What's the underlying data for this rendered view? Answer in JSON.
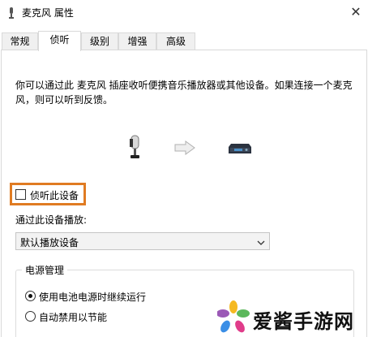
{
  "window": {
    "title": "麦克风 属性",
    "close_glyph": "✕"
  },
  "tabs": [
    {
      "label": "常规",
      "active": false
    },
    {
      "label": "侦听",
      "active": true
    },
    {
      "label": "级别",
      "active": false
    },
    {
      "label": "增强",
      "active": false
    },
    {
      "label": "高级",
      "active": false
    }
  ],
  "listen": {
    "description": "你可以通过此 麦克风 插座收听便携音乐播放器或其他设备。如果连接一个麦克风，则可以听到反馈。",
    "checkbox_label": "侦听此设备",
    "checkbox_checked": false,
    "highlight_color": "#e07b22",
    "play_through_label": "通过此设备播放:",
    "play_through_value": "默认播放设备"
  },
  "power": {
    "group_label": "电源管理",
    "options": [
      {
        "label": "使用电池电源时继续运行",
        "checked": true
      },
      {
        "label": "自动禁用以节能",
        "checked": false
      }
    ]
  },
  "icons": [
    "microphone-icon",
    "arrow-right-icon",
    "playback-device-icon"
  ],
  "watermark": {
    "text": "爱酱手游网"
  }
}
